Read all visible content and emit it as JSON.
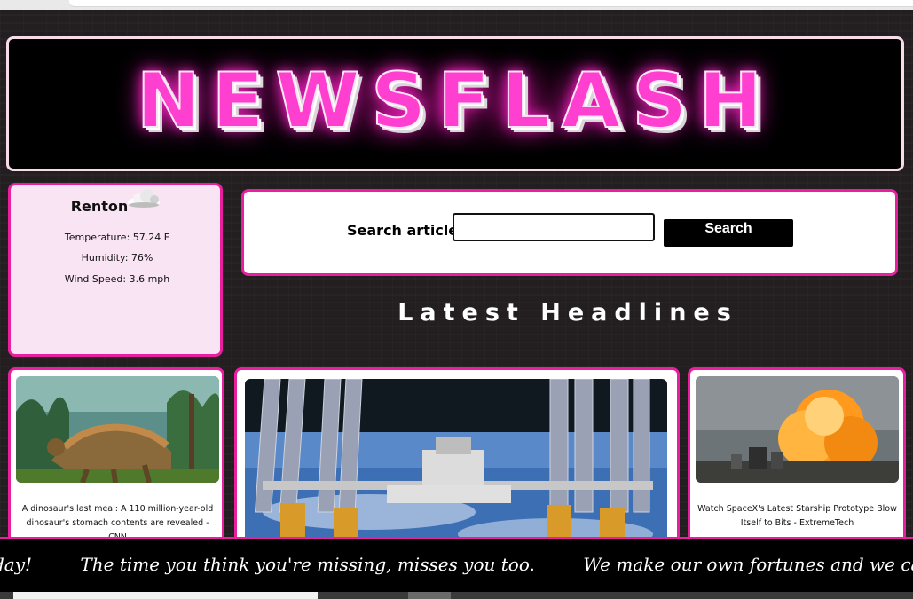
{
  "brand": {
    "logo_text": "NEWSFLASH",
    "accent_color": "#e91fa0",
    "neon_color": "#ff3fcf"
  },
  "weather": {
    "city": "Renton",
    "icon": "cloud-icon",
    "temperature": "Temperature: 57.24 F",
    "humidity": "Humidity: 76%",
    "wind": "Wind Speed: 3.6 mph"
  },
  "search": {
    "label": "Search articles:",
    "input_value": "",
    "button_label": "Search"
  },
  "headlines": {
    "title": "Latest Headlines",
    "cards": [
      {
        "caption": "A dinosaur's last meal: A 110 million-year-old dinosaur's stomach contents are revealed - CNN"
      },
      {
        "caption": ""
      },
      {
        "caption": "Watch SpaceX's Latest Starship Prototype Blow Itself to Bits - ExtremeTech"
      }
    ]
  },
  "ticker": {
    "items": [
      "day!",
      "The time you think you're missing, misses you too.",
      "We make our own fortunes and we call"
    ]
  }
}
